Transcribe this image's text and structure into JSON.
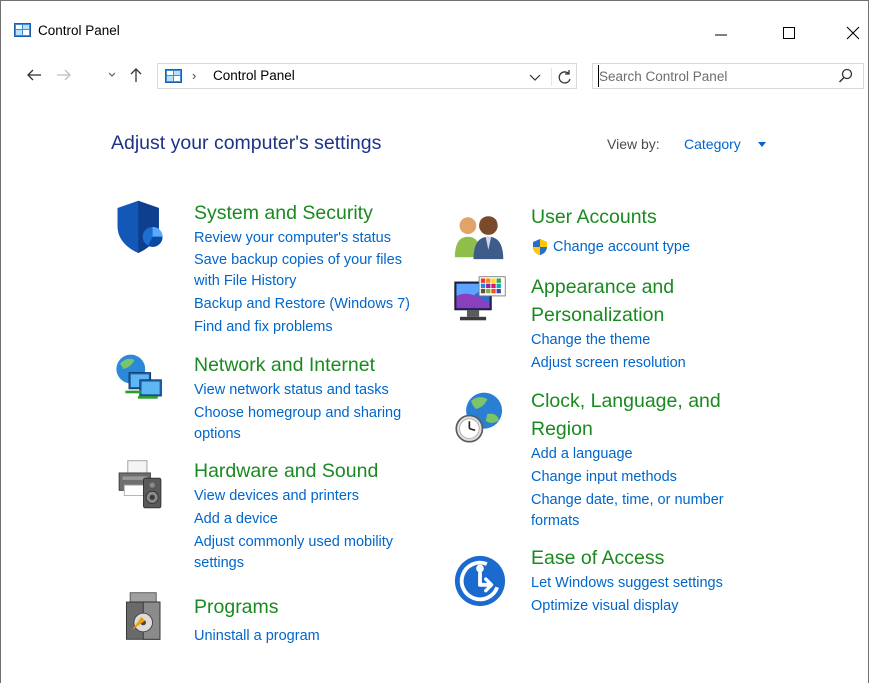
{
  "window": {
    "title": "Control Panel"
  },
  "nav": {
    "breadcrumb": "Control Panel"
  },
  "search": {
    "placeholder": "Search Control Panel"
  },
  "header": {
    "title": "Adjust your computer's settings",
    "view_by_label": "View by:",
    "view_by_value": "Category"
  },
  "categories": [
    {
      "title": "System and Security",
      "icon": "shield-icon",
      "links": [
        "Review your computer's status",
        "Save backup copies of your files",
        "with File History",
        "Backup and Restore (Windows 7)",
        "Find and fix problems"
      ]
    },
    {
      "title": "Network and Internet",
      "icon": "network-icon",
      "links": [
        "View network status and tasks",
        "Choose homegroup and sharing",
        "options"
      ]
    },
    {
      "title": "Hardware and Sound",
      "icon": "printer-icon",
      "links": [
        "View devices and printers",
        "Add a device",
        "Adjust commonly used mobility",
        "settings"
      ]
    },
    {
      "title": "Programs",
      "icon": "programs-icon",
      "links": [
        "Uninstall a program"
      ]
    },
    {
      "title": "User Accounts",
      "icon": "users-icon",
      "links": [
        "Change account type"
      ]
    },
    {
      "title_line1": "Appearance and",
      "title_line2": "Personalization",
      "icon": "monitor-icon",
      "links": [
        "Change the theme",
        "Adjust screen resolution"
      ]
    },
    {
      "title_line1": "Clock, Language, and",
      "title_line2": "Region",
      "icon": "clock-globe-icon",
      "links": [
        "Add a language",
        "Change input methods",
        "Change date, time, or number",
        "formats"
      ]
    },
    {
      "title": "Ease of Access",
      "icon": "ease-of-access-icon",
      "links": [
        "Let Windows suggest settings",
        "Optimize visual display"
      ]
    }
  ],
  "colors": {
    "link": "#0066cc",
    "category_title": "#1a8a20",
    "page_title": "#1e3287"
  }
}
